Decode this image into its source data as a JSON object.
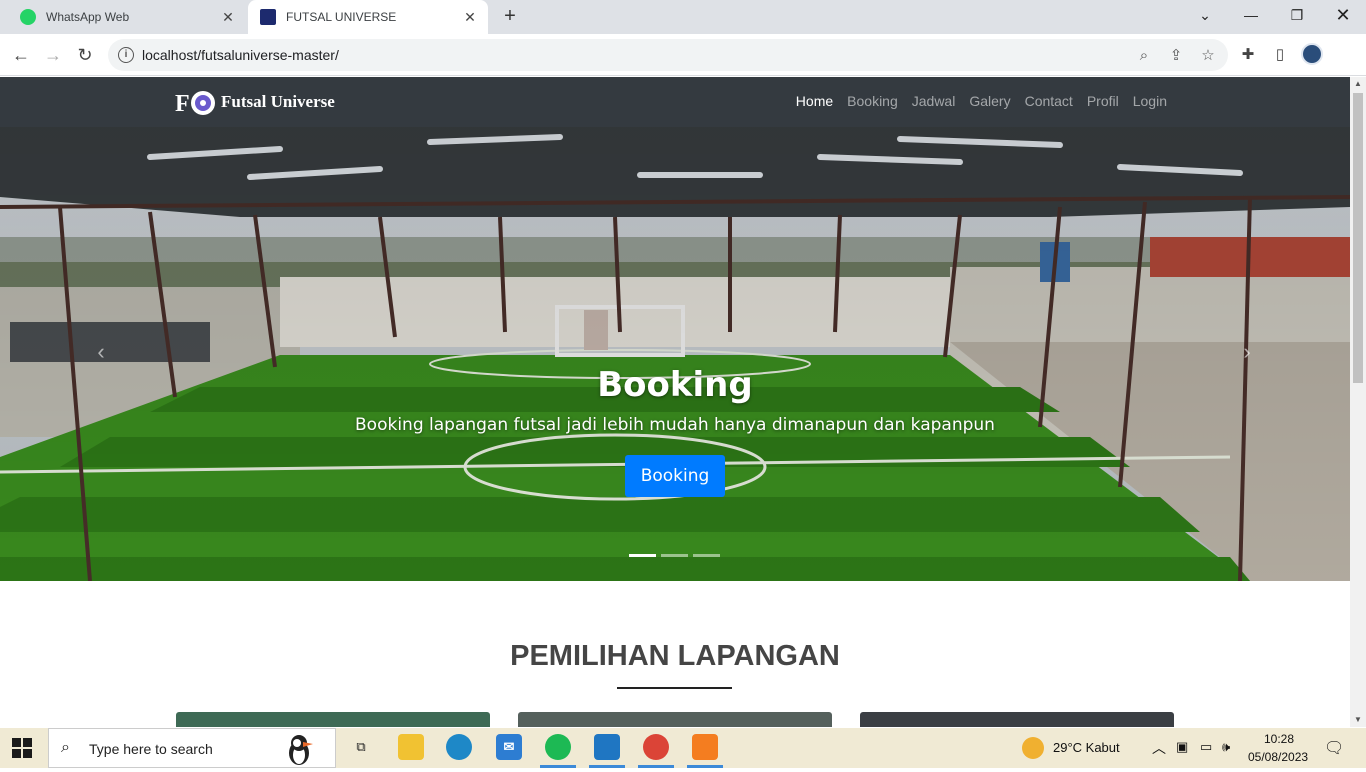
{
  "browser": {
    "tabs": [
      {
        "title": "WhatsApp Web",
        "favicon": "whatsapp-icon",
        "color": "#25d366",
        "active": false
      },
      {
        "title": "FUTSAL UNIVERSE",
        "favicon": "futsal-logo-icon",
        "color": "#1d2a6e",
        "active": true
      }
    ],
    "url": "localhost/futsaluniverse-master/"
  },
  "site": {
    "brand": "Futsal Universe",
    "nav": [
      "Home",
      "Booking",
      "Jadwal",
      "Galery",
      "Contact",
      "Profil",
      "Login"
    ],
    "active_nav": "Home",
    "hero": {
      "title": "Booking",
      "subtitle": "Booking lapangan futsal jadi lebih mudah hanya dimanapun dan kapanpun",
      "button": "Booking",
      "slides": 3,
      "active_slide": 1
    },
    "section_title": "PEMILIHAN LAPANGAN"
  },
  "taskbar": {
    "search_placeholder": "Type here to search",
    "weather": "29°C  Kabut",
    "time": "10:28",
    "date": "05/08/2023",
    "apps": [
      "task-view-icon",
      "file-explorer-icon",
      "edge-icon",
      "mail-icon",
      "spotify-icon",
      "vscode-icon",
      "chrome-icon",
      "xampp-icon"
    ]
  },
  "colors": {
    "navbar_bg": "#343a40",
    "primary_button": "#007bff",
    "taskbar_bg": "#f0ead4"
  }
}
